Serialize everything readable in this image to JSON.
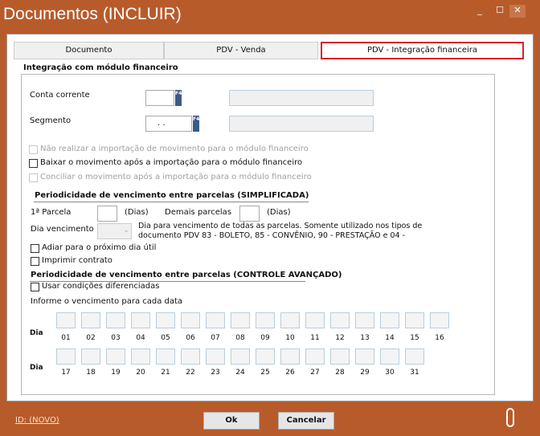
{
  "window": {
    "title": "Documentos (INCLUIR)",
    "minimize": "_",
    "maximize": "☐",
    "close": "✕"
  },
  "tabs": [
    {
      "label": "Documento"
    },
    {
      "label": "PDV - Venda"
    },
    {
      "label": "PDV - Integração financeira"
    }
  ],
  "group_title": "Integração com módulo financeiro",
  "conta_corrente": {
    "label": "Conta corrente",
    "value": "",
    "f4": "F4"
  },
  "segmento": {
    "label": "Segmento",
    "value": ".  .",
    "f4": "F4"
  },
  "checks": [
    {
      "label": "Não realizar a importação de movimento para o módulo financeiro",
      "checked": false,
      "disabled": true
    },
    {
      "label": "Baixar o movimento após a importação para o módulo financeiro",
      "checked": false,
      "disabled": false
    },
    {
      "label": "Conciliar o movimento após a importação para o módulo financeiro",
      "checked": false,
      "disabled": true
    }
  ],
  "simplificada": {
    "title": "Periodicidade de vencimento entre parcelas (SIMPLIFICADA)",
    "primeira": "1ª Parcela",
    "dias1": "(Dias)",
    "demais": "Demais parcelas",
    "dias2": "(Dias)",
    "dia_venc": "Dia vencimento",
    "help1": "Dia para vencimento de todas as parcelas. Somente utilizado nos tipos de",
    "help2": "documento PDV 83 - BOLETO, 85 - CONVÊNIO, 90 - PRESTAÇÃO e 04 -",
    "adiar": "Adiar para o próximo dia útil",
    "imprimir": "Imprimir contrato"
  },
  "avancado": {
    "title": "Periodicidade de vencimento entre parcelas (CONTROLE AVANÇADO)",
    "usar": "Usar condições diferenciadas",
    "informe": "Informe o vencimento para cada data",
    "dia_label": "Dia",
    "row1": [
      "01",
      "02",
      "03",
      "04",
      "05",
      "06",
      "07",
      "08",
      "09",
      "10",
      "11",
      "12",
      "13",
      "14",
      "15",
      "16"
    ],
    "row2": [
      "17",
      "18",
      "19",
      "20",
      "21",
      "22",
      "23",
      "24",
      "25",
      "26",
      "27",
      "28",
      "29",
      "30",
      "31"
    ]
  },
  "footer": {
    "id": "ID: (NOVO)",
    "ok": "Ok",
    "cancel": "Cancelar"
  }
}
